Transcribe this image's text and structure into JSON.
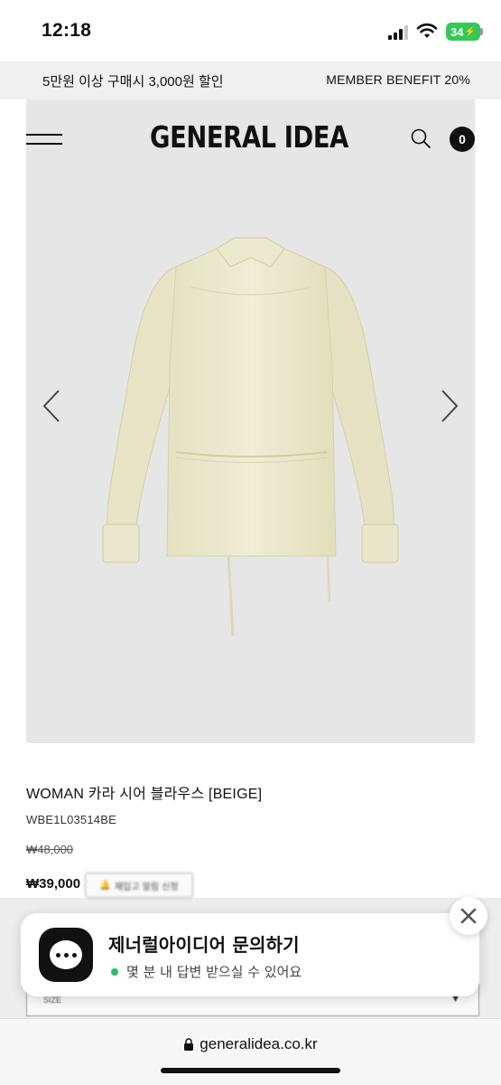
{
  "status_bar": {
    "time": "12:18",
    "battery": "34",
    "icons": [
      "signal-icon",
      "wifi-icon",
      "battery-icon"
    ]
  },
  "promo": {
    "left": "5만원 이상 구매시 3,000원 할인",
    "right": "MEMBER BENEFIT 20%"
  },
  "header": {
    "logo": "GENERAL IDEA",
    "cart_count": "0",
    "icons": [
      "menu-icon",
      "search-icon",
      "cart-icon"
    ]
  },
  "gallery": {
    "icons": [
      "chevron-left-icon",
      "chevron-right-icon"
    ],
    "image": "beige-blouse-product-photo"
  },
  "product": {
    "name": "WOMAN 카라 시어 블라우스 [BEIGE]",
    "code": "WBE1L03514BE",
    "original_price": "₩48,000",
    "sale_price": "₩39,000",
    "restock_label": "재입고 알림 신청"
  },
  "option": {
    "size_label": "SIZE",
    "caret": "▼"
  },
  "chat": {
    "title": "제너럴아이디어 문의하기",
    "subtitle": "몇 분 내 답변 받으실 수 있어요",
    "status_color": "#2dbe60"
  },
  "browser": {
    "url": "generalidea.co.kr"
  },
  "colors": {
    "accent": "#111111",
    "banner_bg": "#f0f0f0",
    "gallery_bg": "#e6e6e6",
    "blouse": "#ecebcf"
  }
}
